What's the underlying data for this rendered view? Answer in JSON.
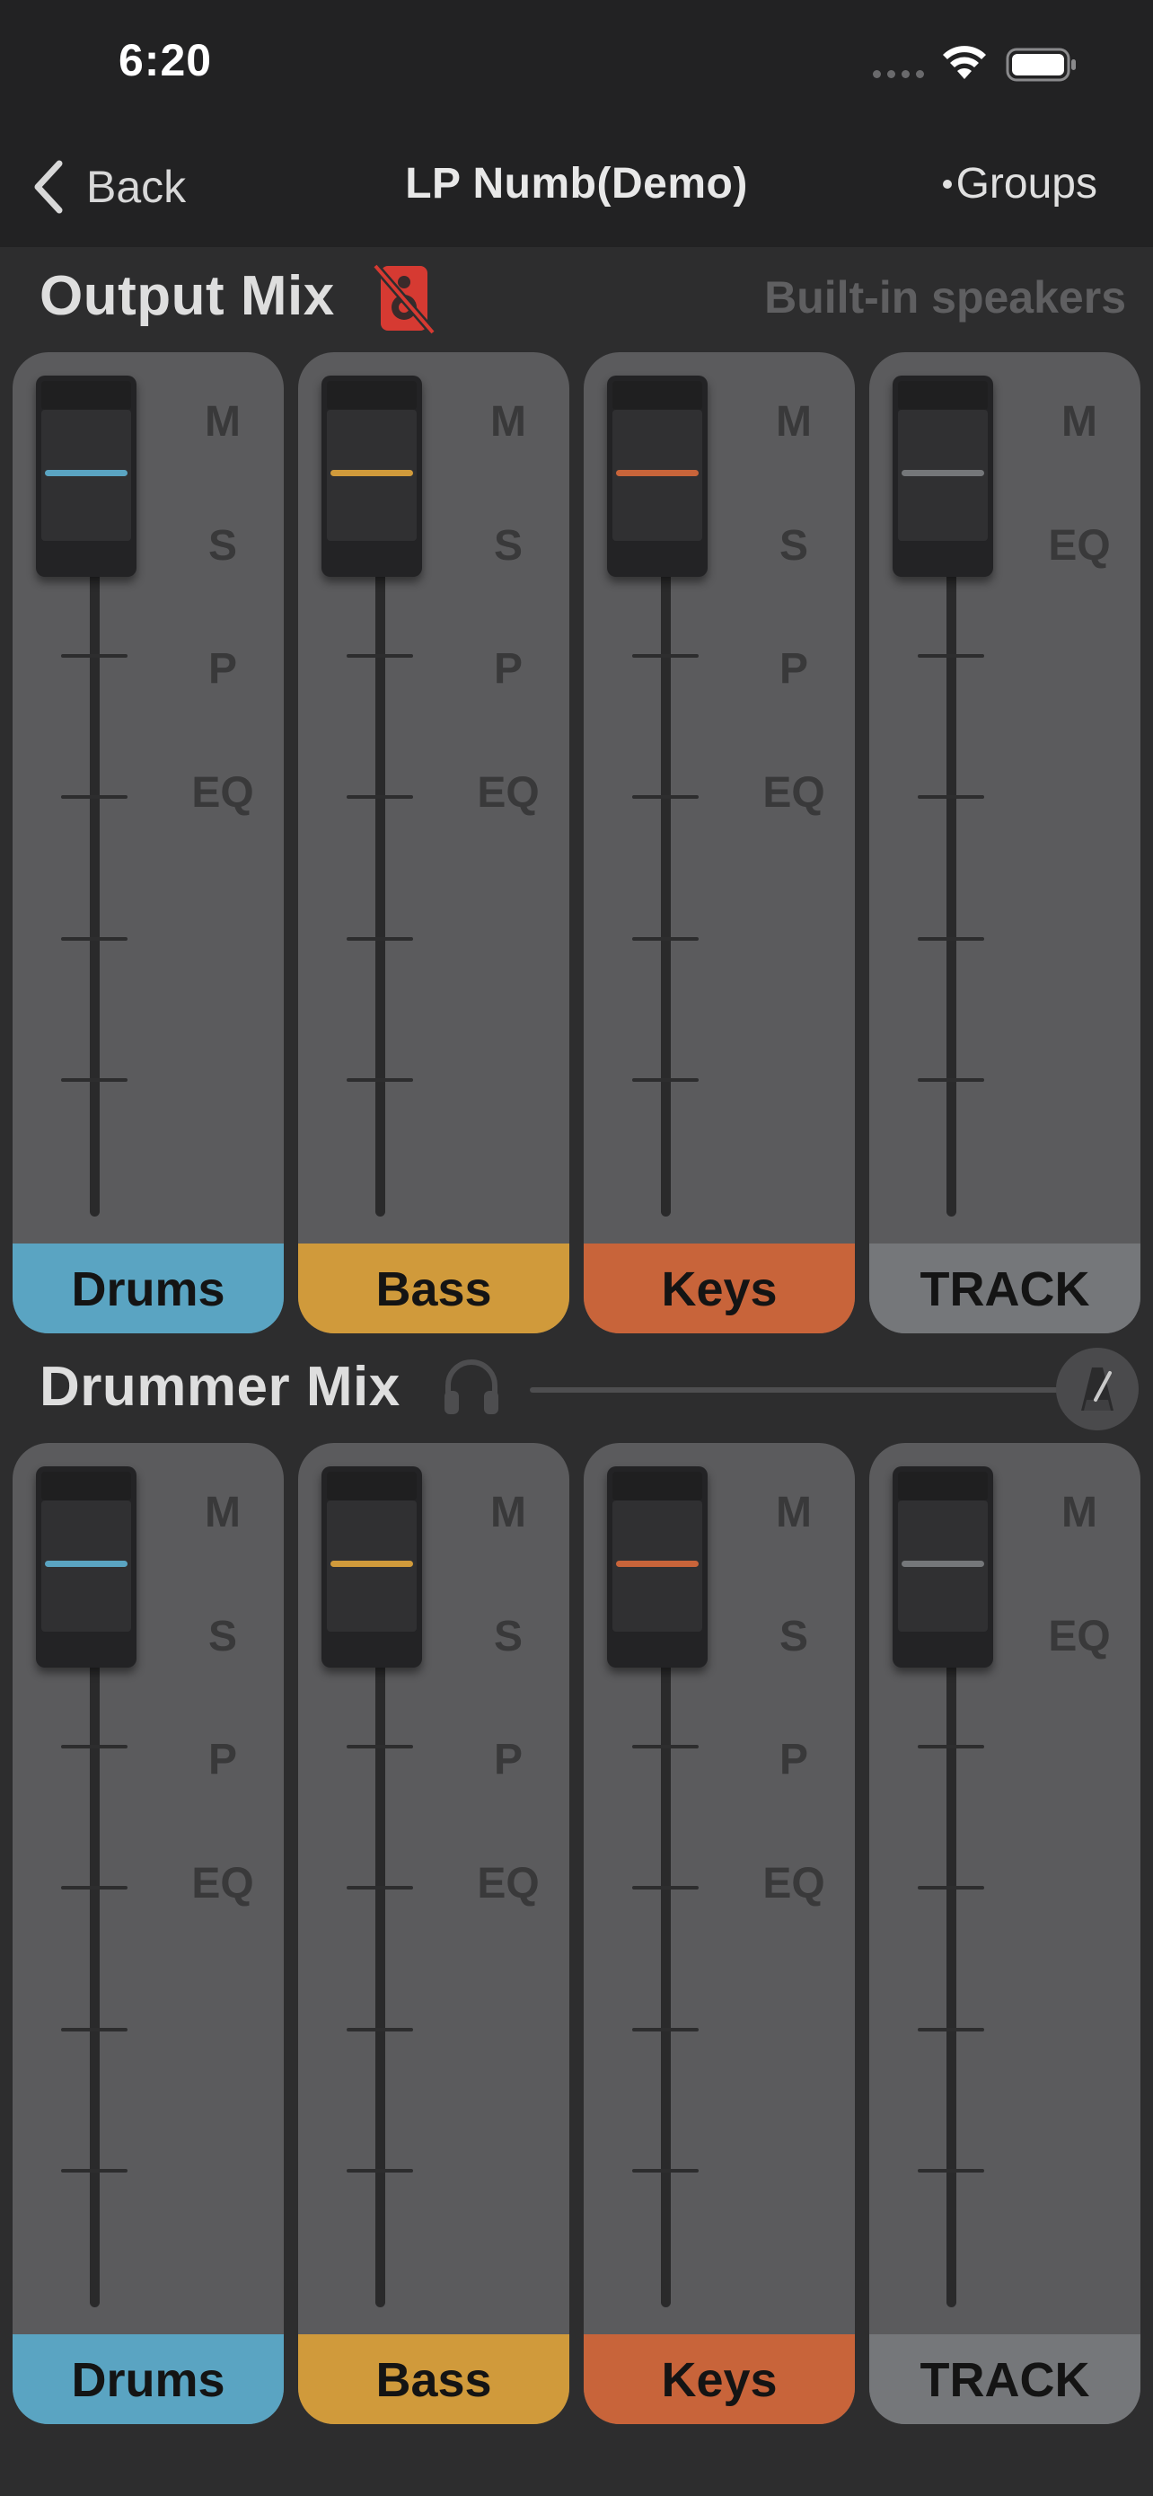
{
  "status_bar": {
    "time": "6:20"
  },
  "nav": {
    "back_label": "Back",
    "title": "LP Numb(Demo)",
    "groups_label": "Groups"
  },
  "output_mix": {
    "title": "Output Mix",
    "device": "Built-in speakers",
    "speaker_icon": "speaker-muted-icon",
    "channels": [
      {
        "name": "Drums",
        "color": "#5aa4c2",
        "buttons": [
          "M",
          "S",
          "P",
          "EQ"
        ]
      },
      {
        "name": "Bass",
        "color": "#d09a3b",
        "buttons": [
          "M",
          "S",
          "P",
          "EQ"
        ]
      },
      {
        "name": "Keys",
        "color": "#c8643a",
        "buttons": [
          "M",
          "S",
          "P",
          "EQ"
        ]
      },
      {
        "name": "TRACK",
        "color": "#75777a",
        "buttons": [
          "M",
          "EQ"
        ]
      }
    ]
  },
  "drummer_mix": {
    "title": "Drummer Mix",
    "headphones_icon": "headphones-icon",
    "metronome_icon": "metronome-icon",
    "channels": [
      {
        "name": "Drums",
        "color": "#5aa4c2",
        "buttons": [
          "M",
          "S",
          "P",
          "EQ"
        ]
      },
      {
        "name": "Bass",
        "color": "#d09a3b",
        "buttons": [
          "M",
          "S",
          "P",
          "EQ"
        ]
      },
      {
        "name": "Keys",
        "color": "#c8643a",
        "buttons": [
          "M",
          "S",
          "P",
          "EQ"
        ]
      },
      {
        "name": "TRACK",
        "color": "#75777a",
        "buttons": [
          "M",
          "EQ"
        ]
      }
    ]
  }
}
